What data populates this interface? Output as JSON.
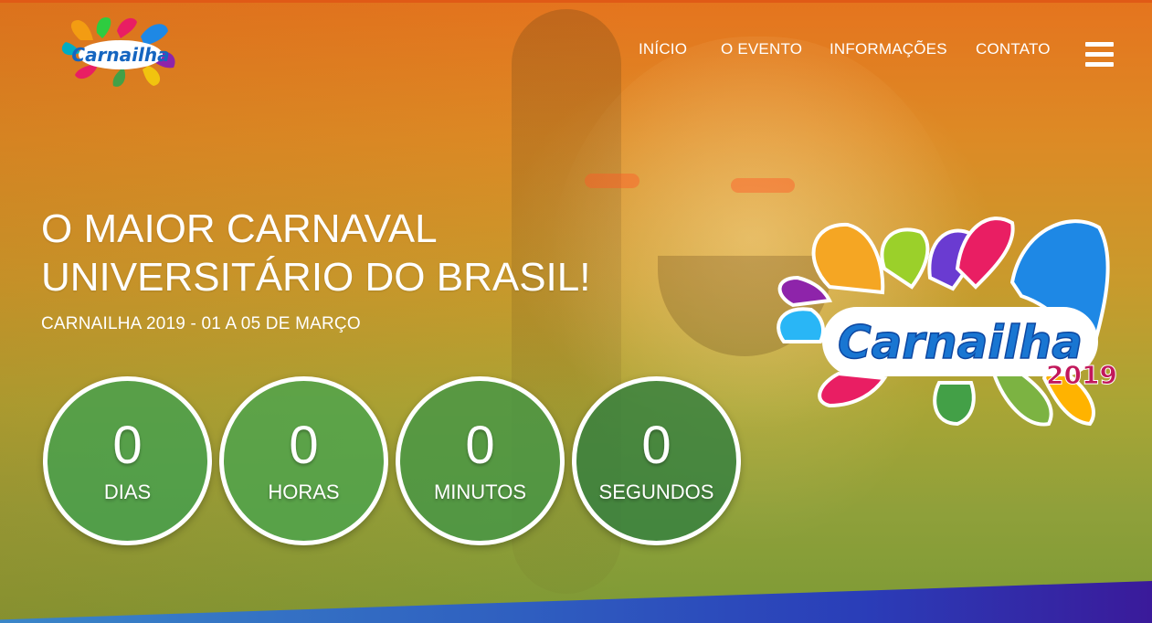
{
  "brand": {
    "logo_text": "Carnailha",
    "big_logo_text": "Carnailha",
    "big_logo_year": "2019"
  },
  "nav": {
    "items": [
      {
        "label": "INÍCIO"
      },
      {
        "label": "O EVENTO"
      },
      {
        "label": "INFORMAÇÕES"
      },
      {
        "label": "CONTATO"
      }
    ]
  },
  "hero": {
    "headline_line1": "O MAIOR CARNAVAL",
    "headline_line2": "UNIVERSITÁRIO DO BRASIL!",
    "subheadline": "CARNAILHA 2019 - 01 A 05 DE MARÇO"
  },
  "countdown": {
    "days": {
      "value": "0",
      "label": "DIAS"
    },
    "hours": {
      "value": "0",
      "label": "HORAS"
    },
    "minutes": {
      "value": "0",
      "label": "MINUTOS"
    },
    "seconds": {
      "value": "0",
      "label": "SEGUNDOS"
    }
  },
  "colors": {
    "accent_orange": "#e5741e",
    "circle_green": "#40a050",
    "band_blue": "#2f5fc0",
    "band_purple": "#3a1a9a"
  },
  "icons": {
    "menu": "hamburger-menu-icon"
  }
}
